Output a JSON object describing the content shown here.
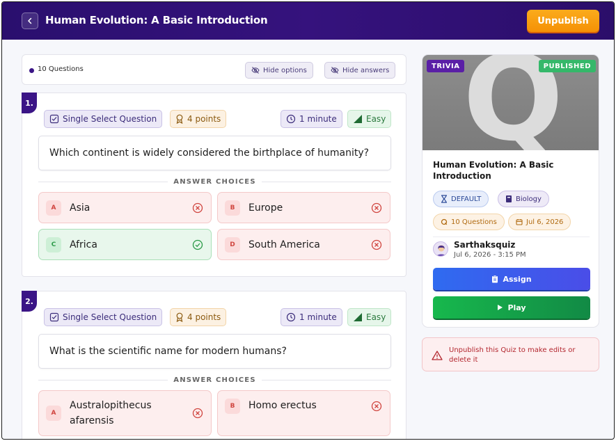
{
  "header": {
    "title": "Human Evolution: A Basic Introduction",
    "unpublish_label": "Unpublish"
  },
  "toolbar": {
    "question_count": "10 Questions",
    "hide_options_label": "Hide options",
    "hide_answers_label": "Hide answers"
  },
  "answer_choices_label": "ANSWER CHOICES",
  "questions": [
    {
      "number": "1.",
      "type": "Single Select Question",
      "points": "4 points",
      "time": "1 minute",
      "difficulty": "Easy",
      "text": "Which continent is widely considered the birthplace of humanity?",
      "choices": [
        {
          "letter": "A",
          "text": "Asia",
          "correct": false
        },
        {
          "letter": "B",
          "text": "Europe",
          "correct": false
        },
        {
          "letter": "C",
          "text": "Africa",
          "correct": true
        },
        {
          "letter": "D",
          "text": "South America",
          "correct": false
        }
      ]
    },
    {
      "number": "2.",
      "type": "Single Select Question",
      "points": "4 points",
      "time": "1 minute",
      "difficulty": "Easy",
      "text": "What is the scientific name for modern humans?",
      "choices": [
        {
          "letter": "A",
          "text": "Australopithecus afarensis",
          "correct": false
        },
        {
          "letter": "B",
          "text": "Homo erectus",
          "correct": false
        }
      ]
    }
  ],
  "sidebar": {
    "cover_letter": "Q",
    "trivia_badge": "TRIVIA",
    "published_badge": "PUBLISHED",
    "title": "Human Evolution: A Basic Introduction",
    "tag_default": "DEFAULT",
    "tag_subject": "Biology",
    "tag_questions": "10 Questions",
    "tag_date": "Jul 6, 2026",
    "author": "Sarthaksquiz",
    "author_date": "Jul 6, 2026 - 3:15 PM",
    "assign_label": "Assign",
    "play_label": "Play",
    "warning": "Unpublish this Quiz to make edits or delete it"
  },
  "colors": {
    "header_bg": "#2a0f6e",
    "accent_purple": "#3b1586",
    "unpublish_orange": "#f59105",
    "correct_green": "#2a9a47",
    "wrong_red": "#d0453f",
    "assign_blue": "#2f6bf0",
    "play_green": "#17b84d"
  }
}
